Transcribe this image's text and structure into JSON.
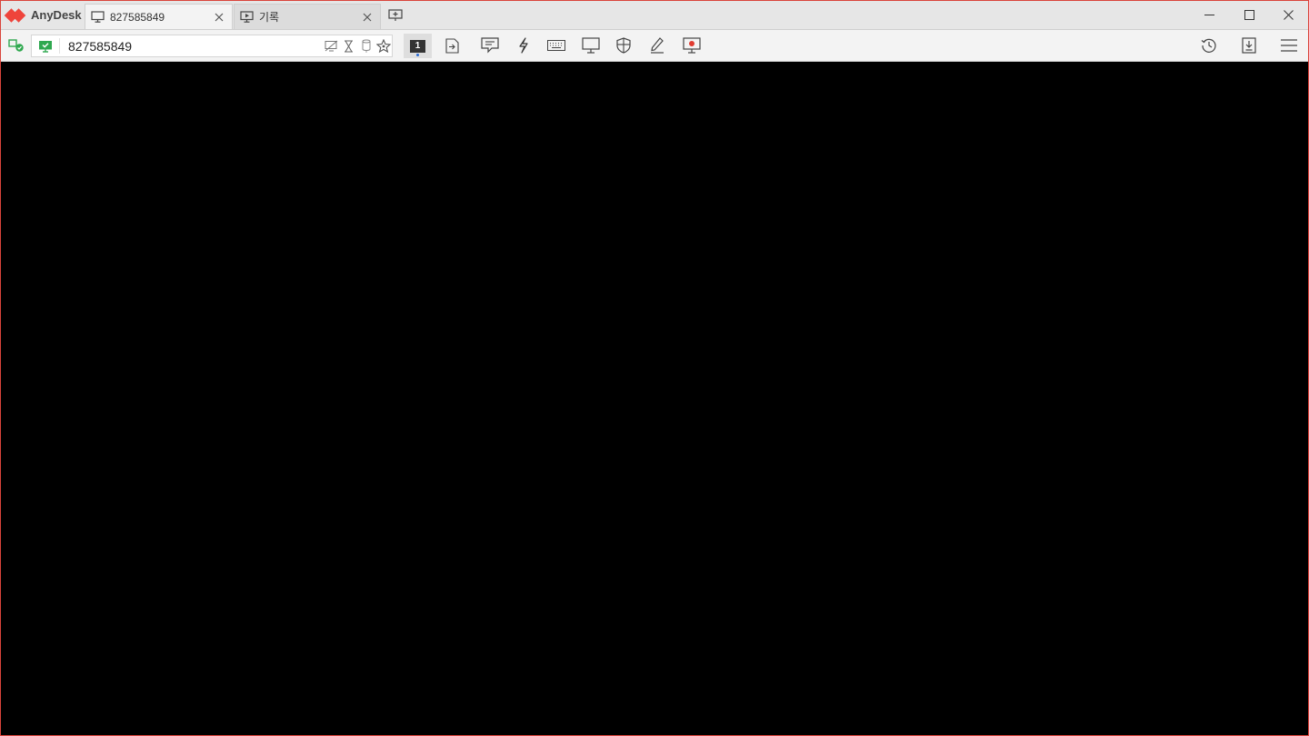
{
  "app": {
    "name": "AnyDesk",
    "brand_color": "#ef443b"
  },
  "tabs": [
    {
      "label": "827585849",
      "icon": "monitor-icon",
      "active": true
    },
    {
      "label": "기록",
      "icon": "recording-icon",
      "active": false
    }
  ],
  "toolbar": {
    "address_value": "827585849",
    "display_number": "1",
    "status_color": "#2fa84f",
    "recording_color": "#e03c31"
  }
}
